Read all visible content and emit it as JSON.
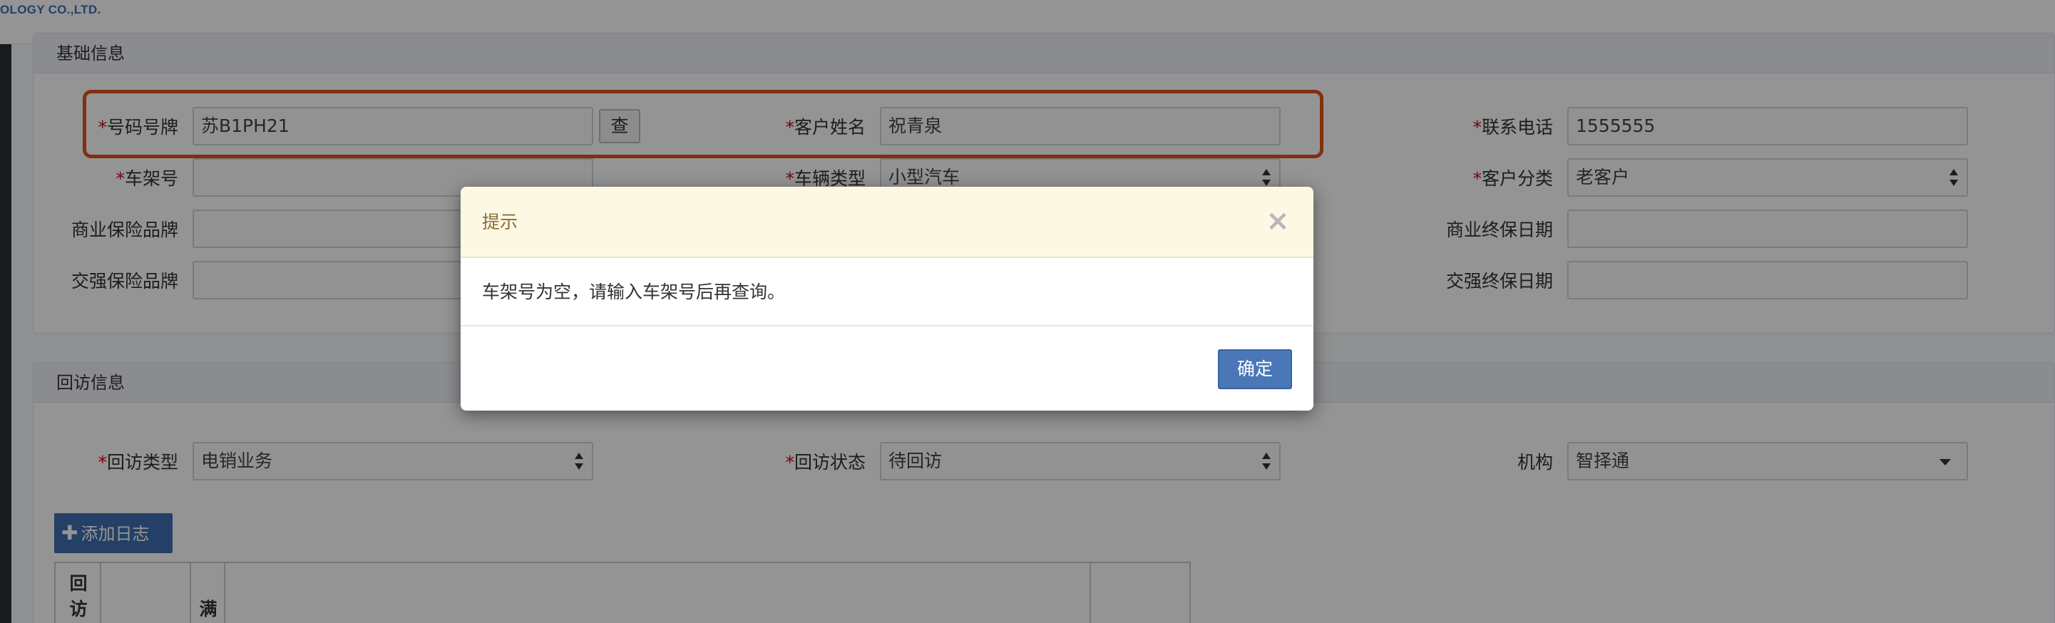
{
  "brand": {
    "text": "OLOGY CO.,LTD."
  },
  "basic_info": {
    "title": "基础信息",
    "required_mark": "*",
    "fields": {
      "plate": {
        "label": "号码号牌",
        "value": "苏B1PH21",
        "search_label": "查"
      },
      "customer_name": {
        "label": "客户姓名",
        "value": "祝青泉"
      },
      "phone": {
        "label": "联系电话",
        "value": "1555555"
      },
      "vin": {
        "label": "车架号",
        "value": ""
      },
      "vehicle_type": {
        "label": "车辆类型",
        "value": "小型汽车"
      },
      "customer_category": {
        "label": "客户分类",
        "value": "老客户"
      },
      "commercial_brand": {
        "label": "商业保险品牌",
        "value": ""
      },
      "commercial_end_date": {
        "label": "商业终保日期",
        "value": ""
      },
      "compulsory_brand": {
        "label": "交强保险品牌",
        "value": ""
      },
      "compulsory_end_date": {
        "label": "交强终保日期",
        "value": ""
      }
    }
  },
  "visit_info": {
    "title": "回访信息",
    "required_mark": "*",
    "fields": {
      "visit_type": {
        "label": "回访类型",
        "value": "电销业务"
      },
      "visit_status": {
        "label": "回访状态",
        "value": "待回访"
      },
      "org": {
        "label": "机构",
        "value": "智择通"
      }
    },
    "add_log_label": "添加日志",
    "table_headers": [
      "回",
      "访",
      "满"
    ]
  },
  "modal": {
    "title": "提示",
    "close_glyph": "×",
    "message": "车架号为空，请输入车架号后再查询。",
    "confirm_label": "确定"
  },
  "colors": {
    "highlight": "#e0521c",
    "primary": "#3e6fb0",
    "required": "#d0021b",
    "modal_header_bg": "#fcf8e3"
  }
}
